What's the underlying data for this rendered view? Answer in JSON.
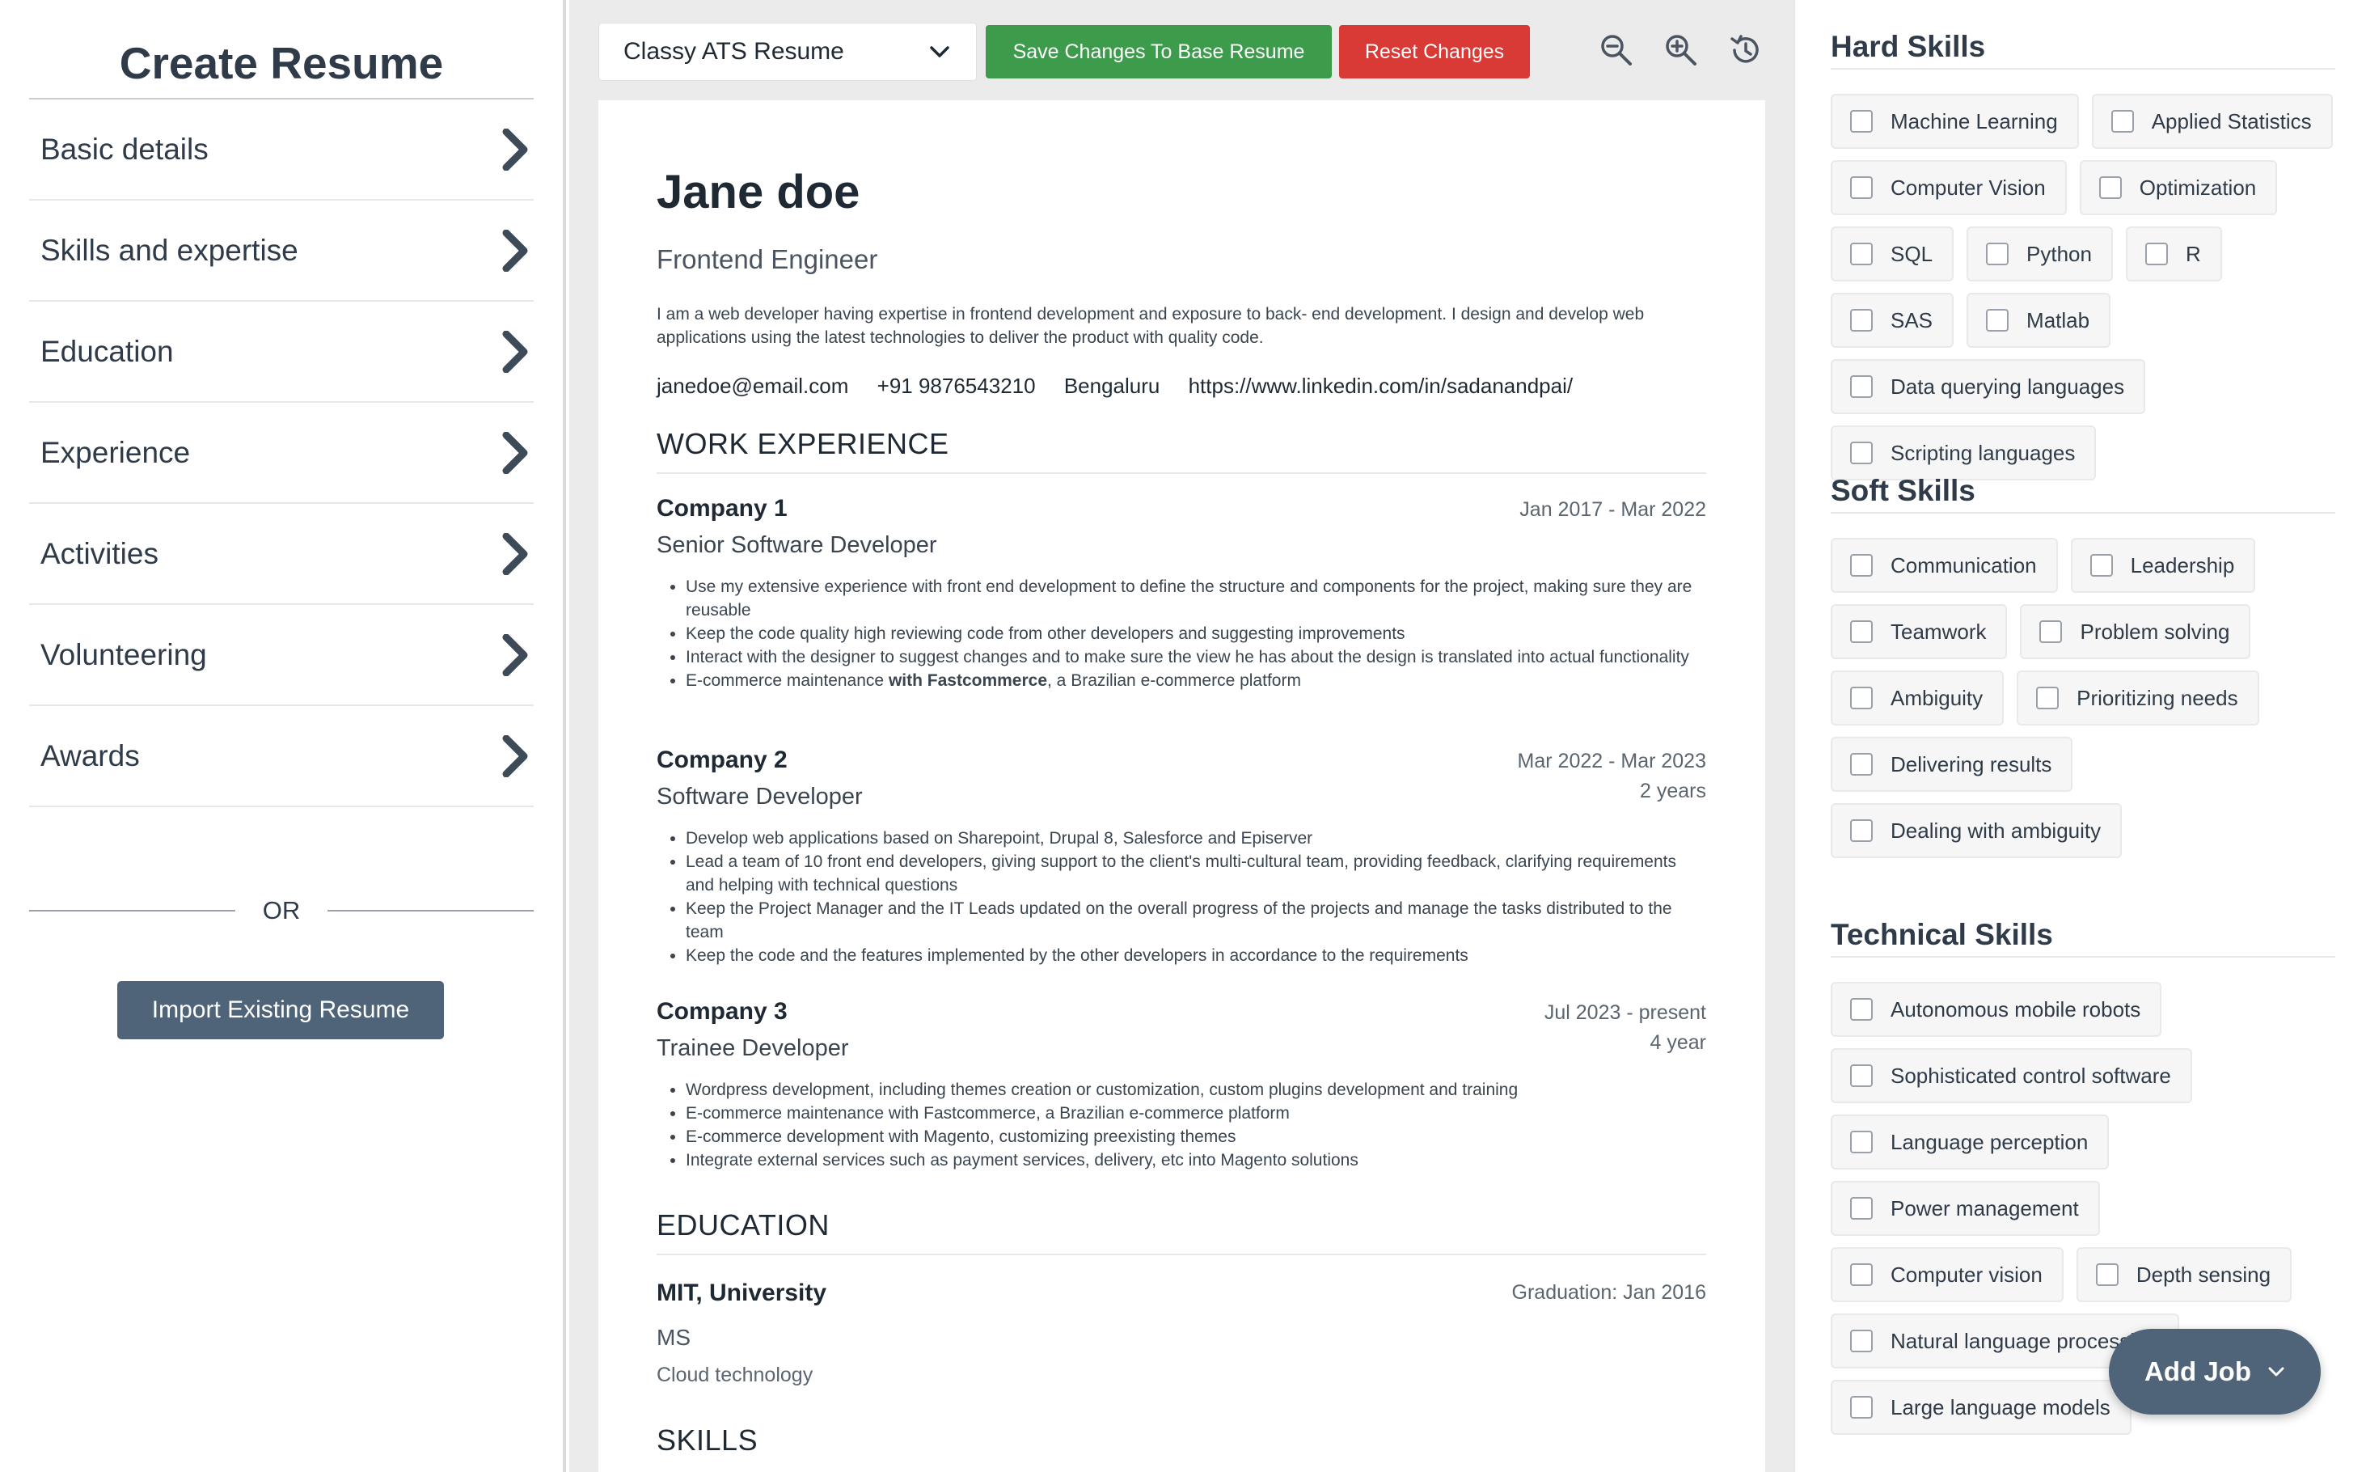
{
  "sidebar": {
    "title": "Create Resume",
    "items": [
      {
        "label": "Basic details"
      },
      {
        "label": "Skills and expertise"
      },
      {
        "label": "Education"
      },
      {
        "label": "Experience"
      },
      {
        "label": "Activities"
      },
      {
        "label": "Volunteering"
      },
      {
        "label": "Awards"
      }
    ],
    "or_label": "OR",
    "import_label": "Import Existing Resume"
  },
  "toolbar": {
    "template_value": "Classy ATS Resume",
    "save_label": "Save Changes To Base Resume",
    "reset_label": "Reset Changes",
    "icons": [
      "zoom-out-icon",
      "zoom-in-icon",
      "history-icon"
    ]
  },
  "resume": {
    "name": "Jane doe",
    "title": "Frontend Engineer",
    "summary": "I am a web developer having expertise in frontend development and exposure to back- end development. I design and develop web applications using the latest technologies to deliver the product with quality code.",
    "contact": {
      "email": "janedoe@email.com",
      "phone": "+91 9876543210",
      "location": "Bengaluru",
      "linkedin": "https://www.linkedin.com/in/sadanandpai/"
    },
    "work_heading": "WORK EXPERIENCE",
    "jobs": [
      {
        "company": "Company 1",
        "role": "Senior Software Developer",
        "dates": "Jan 2017 - Mar 2022",
        "duration": "",
        "bullets": [
          "Use my extensive experience with front end development to define the structure and components for the project, making sure they are reusable",
          "Keep the code quality high reviewing code from other developers and suggesting improvements",
          "Interact with the designer to suggest changes and to make sure the view he has about the design is translated into actual functionality"
        ],
        "bullet_rich": {
          "pre": "E-commerce maintenance ",
          "bold": "with Fastcommerce",
          "post": ", a Brazilian e-commerce platform"
        }
      },
      {
        "company": "Company 2",
        "role": "Software Developer",
        "dates": "Mar 2022 - Mar 2023",
        "duration": "2 years",
        "bullets": [
          "Develop web applications based on Sharepoint, Drupal 8, Salesforce and Episerver",
          "Lead a team of 10 front end developers, giving support to the client's multi-cultural team, providing feedback, clarifying requirements and helping with technical questions",
          "Keep the Project Manager and the IT Leads updated on the overall progress of the projects and manage the tasks distributed to the team",
          "Keep the code and the features implemented by the other developers in accordance to the requirements"
        ]
      },
      {
        "company": "Company 3",
        "role": "Trainee Developer",
        "dates": "Jul 2023 - present",
        "duration": "4 year",
        "bullets": [
          "Wordpress development, including themes creation or customization, custom plugins development and training",
          "E-commerce maintenance with Fastcommerce, a Brazilian e-commerce platform",
          "E-commerce development with Magento, customizing preexisting themes",
          "Integrate external services such as payment services, delivery, etc into Magento solutions"
        ]
      }
    ],
    "education_heading": "EDUCATION",
    "education": {
      "school": "MIT, University",
      "graduation": "Graduation: Jan 2016",
      "degree": "MS",
      "field": "Cloud technology"
    },
    "skills_heading": "SKILLS"
  },
  "skills_panel": {
    "hard": {
      "title": "Hard Skills",
      "items": [
        "Machine Learning",
        "Applied Statistics",
        "Computer Vision",
        "Optimization",
        "SQL",
        "Python",
        "R",
        "SAS",
        "Matlab",
        "Data querying languages",
        "Scripting languages"
      ]
    },
    "soft": {
      "title": "Soft Skills",
      "items": [
        "Communication",
        "Leadership",
        "Teamwork",
        "Problem solving",
        "Ambiguity",
        "Prioritizing needs",
        "Delivering results",
        "Dealing with ambiguity"
      ]
    },
    "technical": {
      "title": "Technical Skills",
      "items": [
        "Autonomous mobile robots",
        "Sophisticated control software",
        "Language perception",
        "Power management",
        "Computer vision",
        "Depth sensing",
        "Natural language processing",
        "Large language models"
      ]
    }
  },
  "add_job_label": "Add Job",
  "colors": {
    "primary": "#4f6478",
    "save": "#3c9c4b",
    "reset": "#d93a35"
  }
}
